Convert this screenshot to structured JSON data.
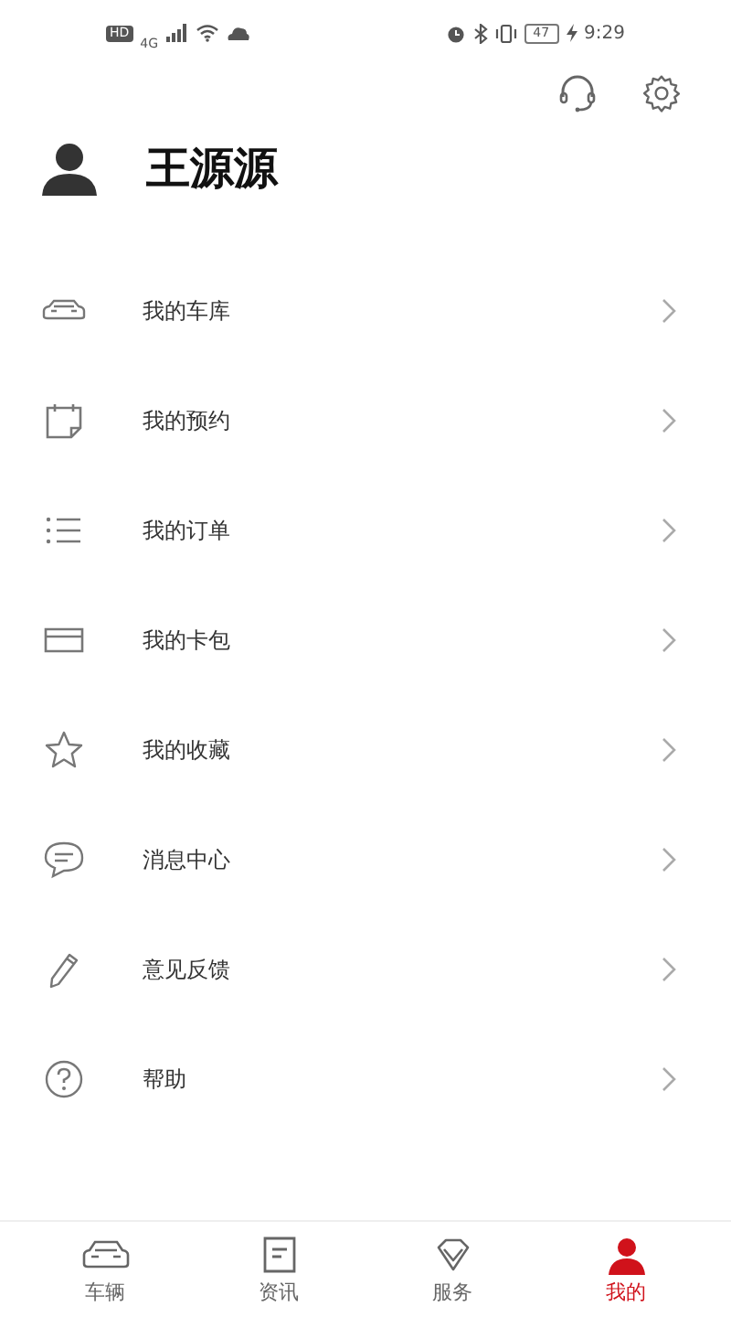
{
  "status_bar": {
    "hd": "HD",
    "network": "4G",
    "battery": "47",
    "time": "9:29"
  },
  "profile": {
    "name": "王源源"
  },
  "menu": [
    {
      "label": "我的车库"
    },
    {
      "label": "我的预约"
    },
    {
      "label": "我的订单"
    },
    {
      "label": "我的卡包"
    },
    {
      "label": "我的收藏"
    },
    {
      "label": "消息中心"
    },
    {
      "label": "意见反馈"
    },
    {
      "label": "帮助"
    }
  ],
  "tabs": [
    {
      "label": "车辆",
      "selected": false
    },
    {
      "label": "资讯",
      "selected": false
    },
    {
      "label": "服务",
      "selected": false
    },
    {
      "label": "我的",
      "selected": true
    }
  ]
}
